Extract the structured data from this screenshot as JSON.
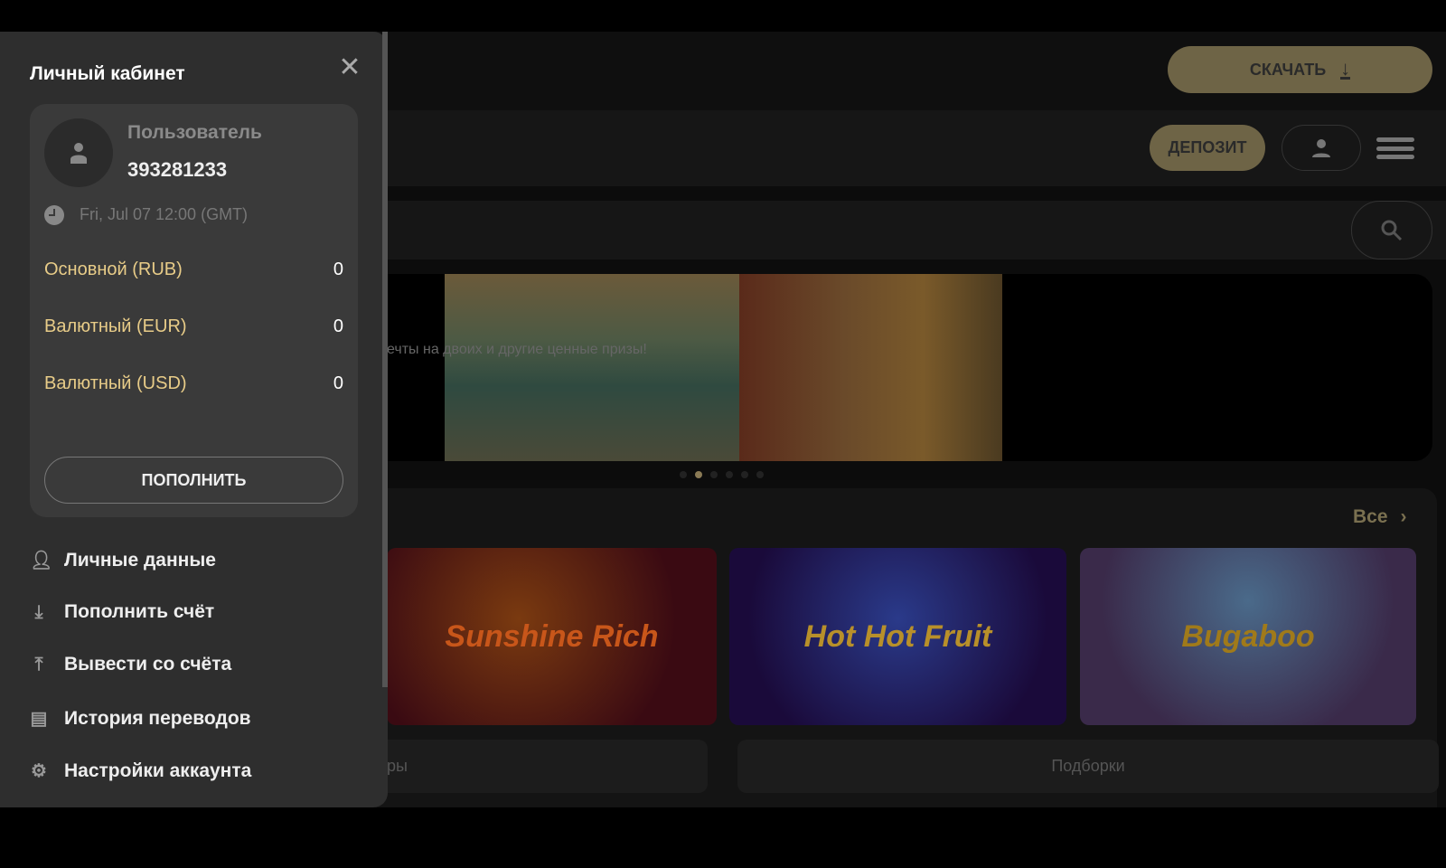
{
  "header": {
    "download_label": "СКАЧАТЬ",
    "deposit_label": "ДЕПОЗИТ"
  },
  "banner": {
    "text": "ечты на двоих и другие ценные призы!",
    "active_slide": 2,
    "slide_count": 6
  },
  "games": {
    "all_label": "Все",
    "tiles": [
      {
        "title": "Sunshine Rich"
      },
      {
        "title": "Hot Hot Fruit"
      },
      {
        "title": "Bugaboo"
      }
    ]
  },
  "bottom": {
    "left_label": "ры",
    "right_label": "Подборки"
  },
  "panel": {
    "title": "Личный кабинет",
    "user_label": "Пользователь",
    "user_id": "393281233",
    "datetime": "Fri, Jul 07 12:00 (GMT)",
    "balances": [
      {
        "name": "Основной (RUB)",
        "value": "0"
      },
      {
        "name": "Валютный (EUR)",
        "value": "0"
      },
      {
        "name": "Валютный (USD)",
        "value": "0"
      }
    ],
    "topup_label": "ПОПОЛНИТЬ",
    "menu": [
      {
        "label": "Личные данные",
        "icon": "user-icon"
      },
      {
        "label": "Пополнить счёт",
        "icon": "download-icon"
      },
      {
        "label": "Вывести со счёта",
        "icon": "upload-icon"
      },
      {
        "label": "История переводов",
        "icon": "history-icon"
      },
      {
        "label": "Настройки аккаунта",
        "icon": "gear-icon"
      }
    ]
  },
  "colors": {
    "accent": "#6e6446",
    "balance_text": "#e8cc88"
  }
}
